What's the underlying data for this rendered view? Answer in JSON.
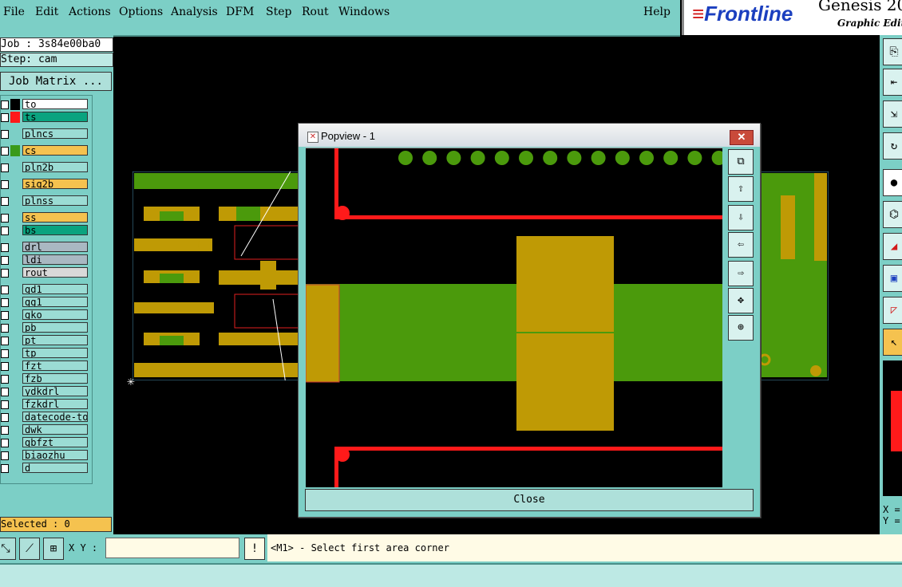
{
  "menu": {
    "items": [
      "File",
      "Edit",
      "Actions",
      "Options",
      "Analysis",
      "DFM",
      "Step",
      "Rout",
      "Windows"
    ],
    "help": "Help"
  },
  "brand": {
    "logo": "Frontline",
    "product": "Genesis 20",
    "subtitle": "Graphic Edito"
  },
  "left_panel": {
    "job": "Job : 3s84e00ba0",
    "step": "Step: cam",
    "job_matrix": "Job Matrix ...",
    "selected": "Selected : 0"
  },
  "layers": [
    {
      "name": "to",
      "bg": "#ffffff",
      "color": "#000000"
    },
    {
      "name": "ts",
      "bg": "#0aa37f",
      "color": "#ff1a1a"
    },
    {
      "name": "plncs",
      "bg": "#9bdcd4",
      "color": ""
    },
    {
      "name": "cs",
      "bg": "#f5c24f",
      "color": "#3a9a1a"
    },
    {
      "name": "pln2b",
      "bg": "#9bdcd4",
      "color": ""
    },
    {
      "name": "sig2b",
      "bg": "#f5c24f",
      "color": ""
    },
    {
      "name": "plnss",
      "bg": "#9bdcd4",
      "color": ""
    },
    {
      "name": "ss",
      "bg": "#f5c24f",
      "color": ""
    },
    {
      "name": "bs",
      "bg": "#0aa37f",
      "color": ""
    },
    {
      "name": "drl",
      "bg": "#a9b8c2",
      "color": ""
    },
    {
      "name": "ldi",
      "bg": "#a9b8c2",
      "color": ""
    },
    {
      "name": "rout",
      "bg": "#d9d9d9",
      "color": ""
    },
    {
      "name": "gd1",
      "bg": "#9bdcd4",
      "color": ""
    },
    {
      "name": "gg1",
      "bg": "#9bdcd4",
      "color": ""
    },
    {
      "name": "gko",
      "bg": "#9bdcd4",
      "color": ""
    },
    {
      "name": "pb",
      "bg": "#9bdcd4",
      "color": ""
    },
    {
      "name": "pt",
      "bg": "#9bdcd4",
      "color": ""
    },
    {
      "name": "tp",
      "bg": "#9bdcd4",
      "color": ""
    },
    {
      "name": "fzt",
      "bg": "#9bdcd4",
      "color": ""
    },
    {
      "name": "fzb",
      "bg": "#9bdcd4",
      "color": ""
    },
    {
      "name": "ydkdrl",
      "bg": "#9bdcd4",
      "color": ""
    },
    {
      "name": "fzkdrl",
      "bg": "#9bdcd4",
      "color": ""
    },
    {
      "name": "datecode-to",
      "bg": "#9bdcd4",
      "color": ""
    },
    {
      "name": "dwk",
      "bg": "#9bdcd4",
      "color": ""
    },
    {
      "name": "gbfzt",
      "bg": "#9bdcd4",
      "color": ""
    },
    {
      "name": "biaozhu",
      "bg": "#9bdcd4",
      "color": ""
    },
    {
      "name": "d",
      "bg": "#9bdcd4",
      "color": ""
    }
  ],
  "bottom": {
    "xy_label": "X Y :",
    "xy_value": "",
    "message": "<M1> - Select first area corner"
  },
  "right": {
    "x_label": "X =",
    "y_label": "Y ="
  },
  "popup": {
    "title": "Popview - 1",
    "close_x": "✕",
    "close_button": "Close"
  },
  "colors": {
    "panel": "#7ccfc6",
    "pad_yellow": "#bf9a05",
    "pad_green": "#4b9a0c",
    "trace_red": "#ff1a1a"
  }
}
